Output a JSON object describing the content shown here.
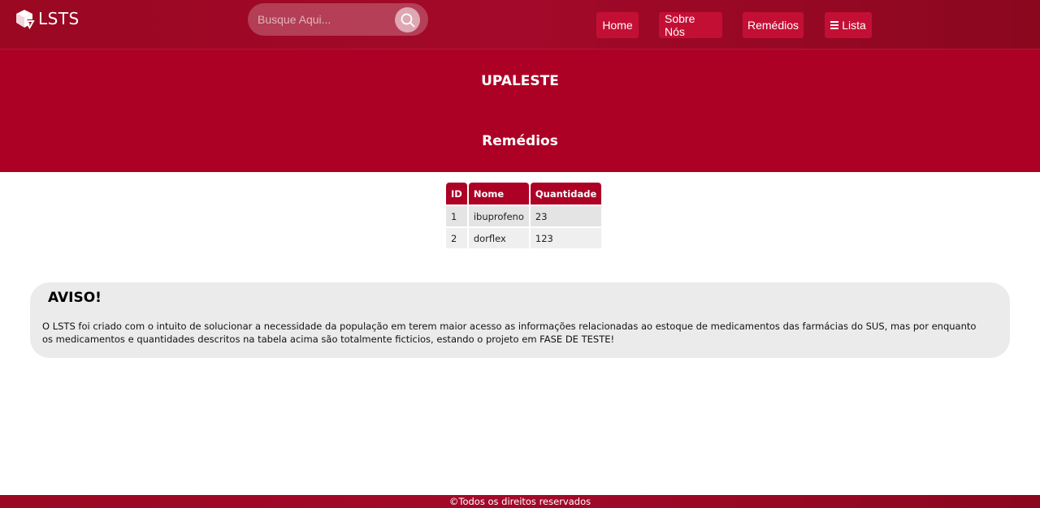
{
  "header": {
    "logo_text": "LSTS",
    "search_placeholder": "Busque Aqui...",
    "nav": {
      "home": "Home",
      "sobre": "Sobre Nós",
      "remedios": "Remédios",
      "lista": "Lista"
    }
  },
  "hero": {
    "title": "UPALESTE",
    "subtitle": "Remédios"
  },
  "table": {
    "headers": [
      "ID",
      "Nome",
      "Quantidade"
    ],
    "rows": [
      [
        "1",
        "ibuprofeno",
        "23"
      ],
      [
        "2",
        "dorflex",
        "123"
      ]
    ]
  },
  "aviso": {
    "title": "AVISO!",
    "text": "O LSTS foi criado com o intuito de solucionar a necessidade da população em terem maior acesso as informações relacionadas ao estoque de medicamentos das farmácias do SUS, mas por enquanto os medicamentos e quantidades descritos na tabela acima são totalmente ficticios, estando o projeto em FASE DE TESTE!"
  },
  "footer": {
    "text": "©Todos os direitos reservados"
  },
  "colors": {
    "brand": "#ad0025",
    "nav_button": "#c40f35",
    "header": "#9a0822",
    "aviso_bg": "#ebebeb"
  },
  "icons": {
    "logo": "cube-logo-icon",
    "search": "search-icon",
    "menu": "hamburger-menu-icon"
  }
}
